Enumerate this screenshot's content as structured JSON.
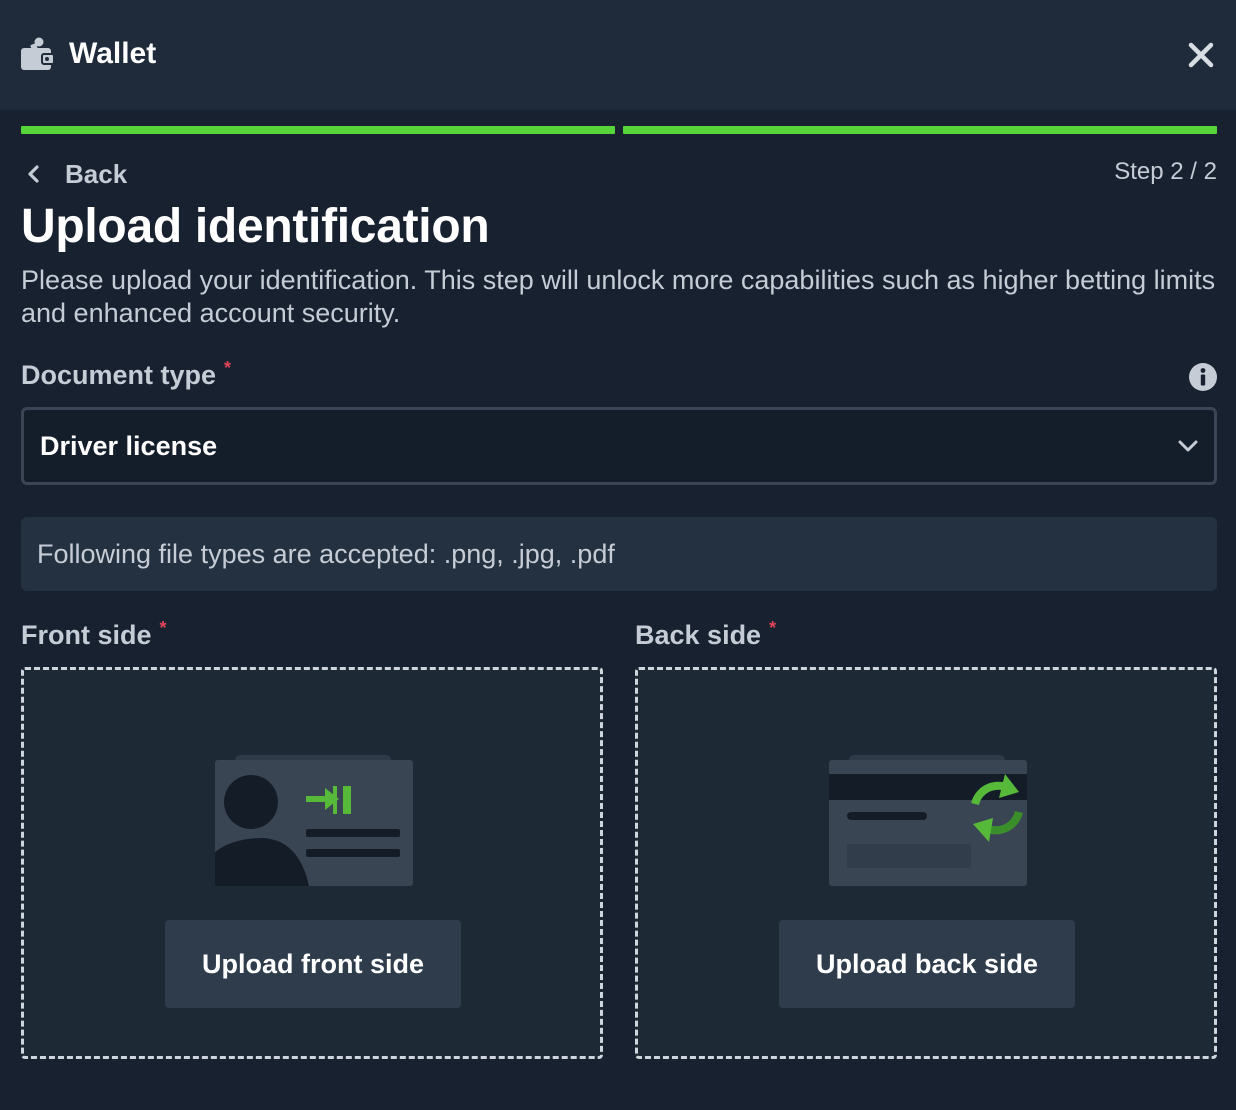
{
  "header": {
    "title": "Wallet",
    "icon": "wallet-icon",
    "close_icon": "close-icon"
  },
  "progress": {
    "steps_completed": 2,
    "steps_total": 2,
    "color": "#56d43a"
  },
  "nav": {
    "back_label": "Back",
    "step_label": "Step 2 / 2"
  },
  "main": {
    "title": "Upload identification",
    "description": "Please upload your identification. This step will unlock more capabilities such as higher betting limits and enhanced account security.",
    "document_type": {
      "label": "Document type",
      "required_mark": "*",
      "selected": "Driver license",
      "info_icon": "info-icon"
    },
    "notice": "Following file types are accepted: .png, .jpg, .pdf",
    "front": {
      "label": "Front side",
      "required_mark": "*",
      "button": "Upload front side",
      "icon": "id-card-front-icon"
    },
    "back": {
      "label": "Back side",
      "required_mark": "*",
      "button": "Upload back side",
      "icon": "id-card-back-flip-icon"
    }
  },
  "colors": {
    "accent_green": "#56d43a",
    "required_red": "#e3455b",
    "background": "#172130"
  }
}
